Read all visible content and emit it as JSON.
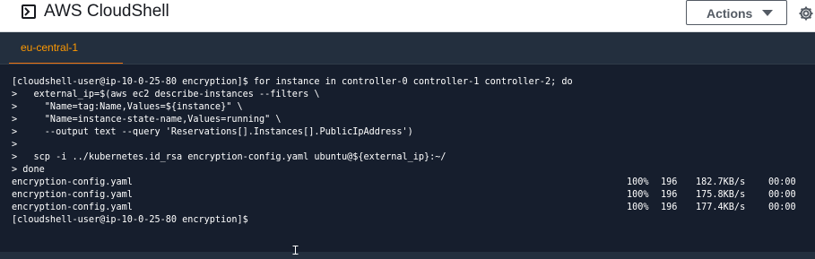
{
  "header": {
    "title": "AWS CloudShell",
    "actions_label": "Actions"
  },
  "tabs": [
    {
      "label": "eu-central-1",
      "active": true
    }
  ],
  "terminal": {
    "lines": [
      "[cloudshell-user@ip-10-0-25-80 encryption]$ for instance in controller-0 controller-1 controller-2; do",
      ">   external_ip=$(aws ec2 describe-instances --filters \\",
      ">     \"Name=tag:Name,Values=${instance}\" \\",
      ">     \"Name=instance-state-name,Values=running\" \\",
      ">     --output text --query 'Reservations[].Instances[].PublicIpAddress')",
      ">",
      ">   scp -i ../kubernetes.id_rsa encryption-config.yaml ubuntu@${external_ip}:~/",
      "> done"
    ],
    "transfers": [
      {
        "file": "encryption-config.yaml",
        "percent": "100%",
        "size": "196",
        "rate": "182.7KB/s",
        "time": "00:00"
      },
      {
        "file": "encryption-config.yaml",
        "percent": "100%",
        "size": "196",
        "rate": "175.8KB/s",
        "time": "00:00"
      },
      {
        "file": "encryption-config.yaml",
        "percent": "100%",
        "size": "196",
        "rate": "177.4KB/s",
        "time": "00:00"
      }
    ],
    "prompt": "[cloudshell-user@ip-10-0-25-80 encryption]$"
  },
  "colors": {
    "accent": "#ec7211",
    "tab_text": "#ff9900",
    "terminal_bg": "#161e2d",
    "chrome_bg": "#232f3e"
  },
  "icons": [
    "terminal-icon",
    "caret-down-icon",
    "gear-icon",
    "text-cursor-icon"
  ]
}
